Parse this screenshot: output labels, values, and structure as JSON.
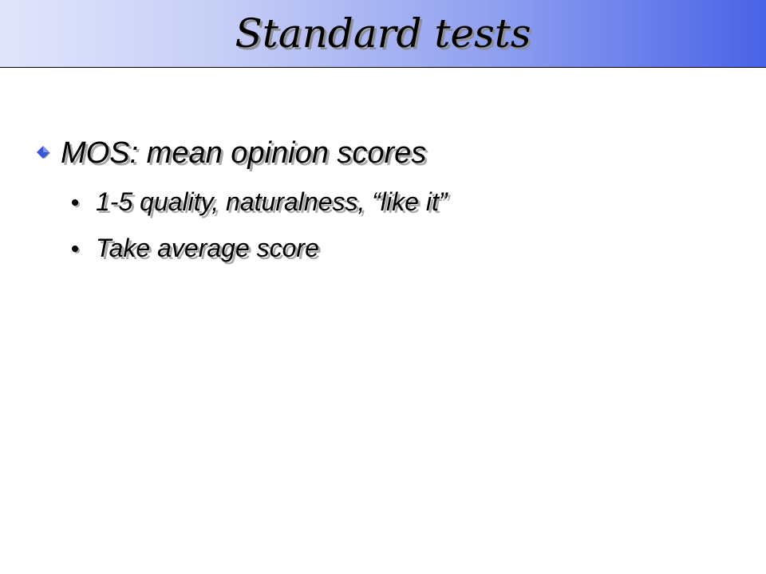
{
  "slide": {
    "title": "Standard tests",
    "bullets": [
      {
        "text": "MOS: mean opinion scores",
        "icon": "diamond-bullet-icon",
        "sub": [
          {
            "text": "1-5 quality, naturalness, “like it”",
            "icon": "dot-bullet-icon"
          },
          {
            "text": "Take average score",
            "icon": "dot-bullet-icon"
          }
        ]
      }
    ]
  },
  "colors": {
    "title_gradient_start": "#e1e5fb",
    "title_gradient_end": "#4a63e6",
    "bullet_diamond": "#3a56d8",
    "text": "#000000",
    "shadow": "#a9a9a9"
  }
}
